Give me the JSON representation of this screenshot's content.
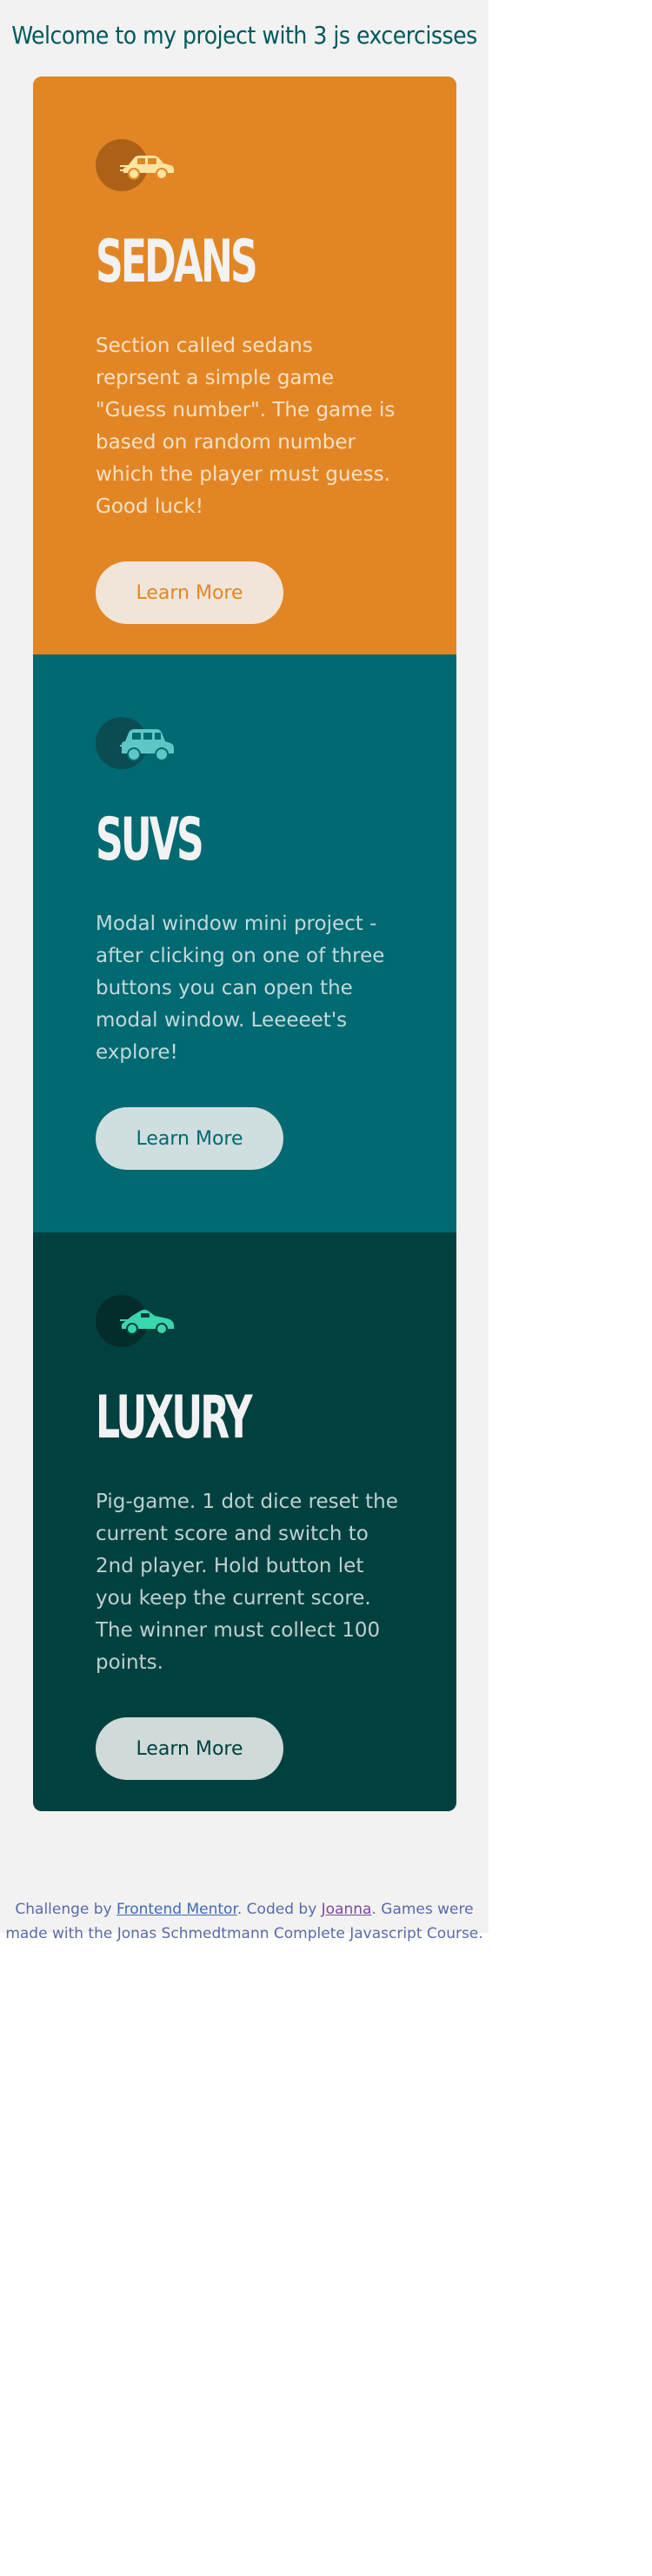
{
  "page": {
    "title": "Welcome to my project with 3 js excercisses"
  },
  "cards": [
    {
      "icon": "sedan-car-icon",
      "heading": "Sedans",
      "text": "Section called sedans reprsent a simple game \"Guess number\". The game is based on random number which the player must guess. Good luck!",
      "button": "Learn More",
      "accent": "#e28625"
    },
    {
      "icon": "suv-car-icon",
      "heading": "SUVs",
      "text": "Modal window mini project - after clicking on one of three buttons you can open the modal window. Leeeeet's explore!",
      "button": "Learn More",
      "accent": "#006971"
    },
    {
      "icon": "luxury-car-icon",
      "heading": "Luxury",
      "text": "Pig-game. 1 dot dice reset the current score and switch to 2nd player. Hold button let you keep the current score. The winner must collect 100 points.",
      "button": "Learn More",
      "accent": "#004140"
    }
  ],
  "attribution": {
    "prefix": "Challenge by ",
    "challenge_link": "Frontend Mentor",
    "middle": ". Coded by ",
    "author_link": "Joanna",
    "suffix": ". Games were made with the Jonas Schmedtmann Complete Javascript Course."
  }
}
